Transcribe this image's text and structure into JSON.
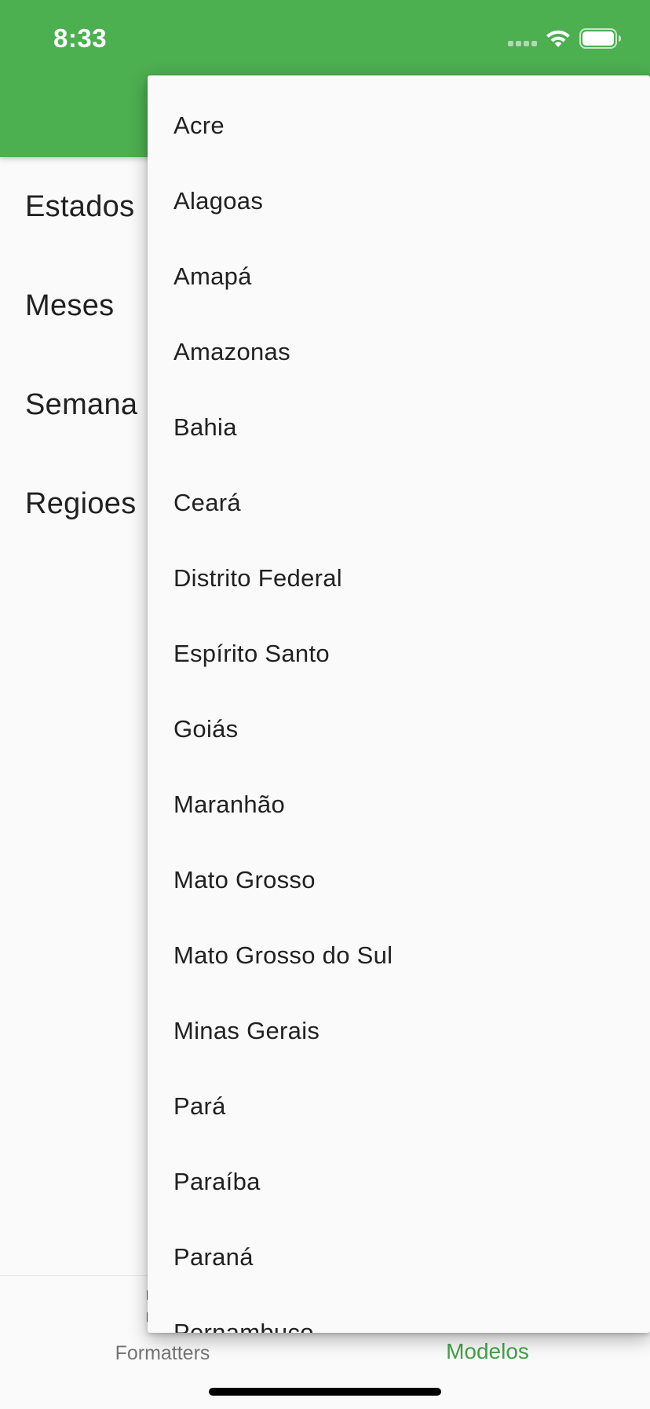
{
  "status_bar": {
    "time": "8:33"
  },
  "app_bar": {
    "color": "#4caf50"
  },
  "list": {
    "items": [
      {
        "label": "Estados"
      },
      {
        "label": "Meses"
      },
      {
        "label": "Semana"
      },
      {
        "label": "Regioes"
      }
    ]
  },
  "dropdown": {
    "items": [
      {
        "label": "Acre"
      },
      {
        "label": "Alagoas"
      },
      {
        "label": "Amapá"
      },
      {
        "label": "Amazonas"
      },
      {
        "label": "Bahia"
      },
      {
        "label": "Ceará"
      },
      {
        "label": "Distrito Federal"
      },
      {
        "label": "Espírito Santo"
      },
      {
        "label": "Goiás"
      },
      {
        "label": "Maranhão"
      },
      {
        "label": "Mato Grosso"
      },
      {
        "label": "Mato Grosso do Sul"
      },
      {
        "label": "Minas Gerais"
      },
      {
        "label": "Pará"
      },
      {
        "label": "Paraíba"
      },
      {
        "label": "Paraná"
      },
      {
        "label": "Pernambuco"
      }
    ]
  },
  "bottom_nav": {
    "items": [
      {
        "label": "Formatters",
        "icon": "format-icon",
        "active": false
      },
      {
        "label": "Modelos",
        "icon": "models-icon",
        "active": true
      }
    ],
    "active_color": "#43a047",
    "inactive_color": "#757575"
  }
}
